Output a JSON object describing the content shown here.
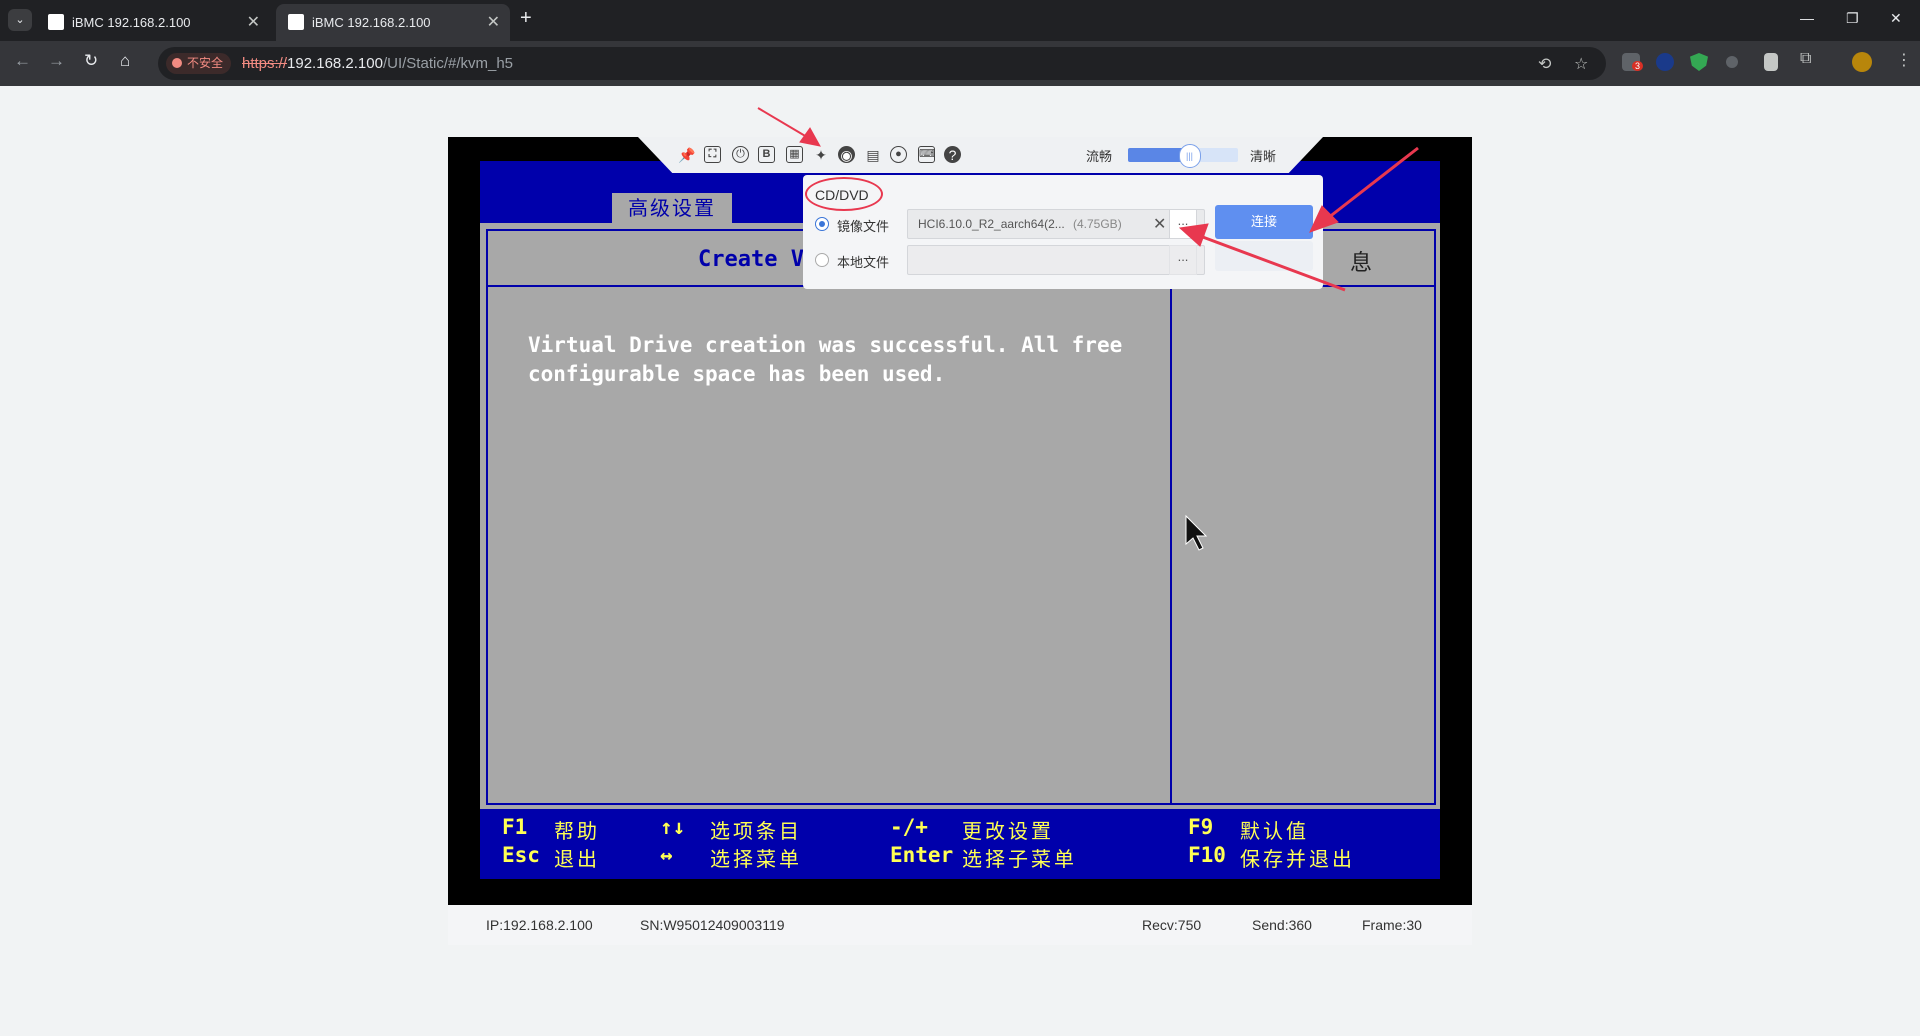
{
  "browser": {
    "tabs": [
      {
        "title": "iBMC 192.168.2.100",
        "active": false
      },
      {
        "title": "iBMC 192.168.2.100",
        "active": true
      }
    ],
    "security_chip": "不安全",
    "url_scheme": "https://",
    "url_host": "192.168.2.100",
    "url_path": "/UI/Static/#/kvm_h5",
    "extension_badge": "3"
  },
  "kvm": {
    "quality_low": "流畅",
    "quality_high": "清晰",
    "quality_level": 0.55,
    "toolbar_icons": [
      "pin-icon",
      "fullscreen-icon",
      "power-icon",
      "boot-icon",
      "keyboard-macro-icon",
      "mouse-icon",
      "cd-dvd-icon",
      "floppy-icon",
      "record-icon",
      "keyboard-icon",
      "help-icon"
    ]
  },
  "cd_dvd": {
    "title": "CD/DVD",
    "image_file_label": "镜像文件",
    "local_file_label": "本地文件",
    "image_file_name": "HCI6.10.0_R2_aarch64(2...",
    "image_file_size": "(4.75GB)",
    "clear_symbol": "✕",
    "browse_label": "...",
    "connect_label": "连接",
    "selected": "image"
  },
  "bios": {
    "tab": "高级设置",
    "title": "Create Vi",
    "help_glyph": "息",
    "message_line1": "Virtual Drive creation was successful. All free",
    "message_line2": "configurable space has been used.",
    "footer": {
      "f1_key": "F1",
      "f1_desc": "帮助",
      "esc_key": "Esc",
      "esc_desc": "退出",
      "updown_key": "↑↓",
      "updown_desc": "选项条目",
      "leftright_key": "↔",
      "leftright_desc": "选择菜单",
      "plusminus_key": "-/+",
      "plusminus_desc": "更改设置",
      "enter_key": "Enter",
      "enter_desc": "选择子菜单",
      "f9_key": "F9",
      "f9_desc": "默认值",
      "f10_key": "F10",
      "f10_desc": "保存并退出"
    }
  },
  "status": {
    "ip": "IP:192.168.2.100",
    "sn": "SN:W95012409003119",
    "recv": "Recv:750",
    "send": "Send:360",
    "frame": "Frame:30"
  },
  "colors": {
    "bios_blue": "#0000ab",
    "bios_gray": "#a8a8a8",
    "bios_yellow": "#ffff54",
    "connect_blue": "#5f8ff0",
    "annotation_red": "#e8384f"
  }
}
